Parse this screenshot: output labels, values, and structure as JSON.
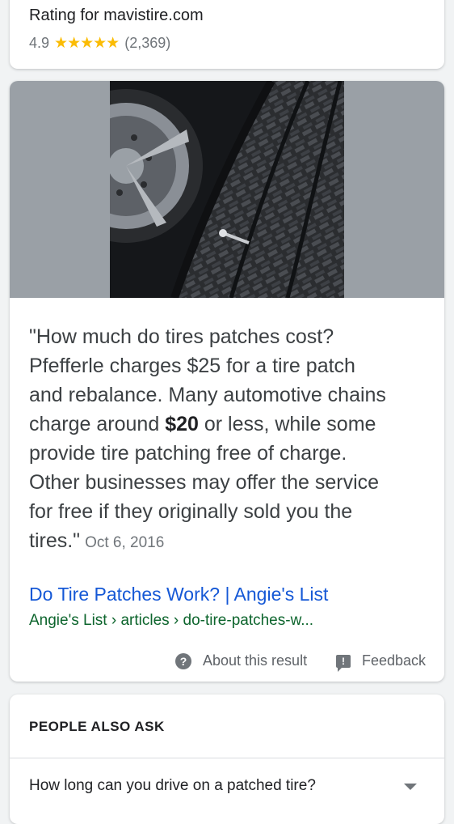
{
  "rating": {
    "title": "Rating for mavistire.com",
    "score": "4.9",
    "stars": "★★★★★",
    "count": "(2,369)"
  },
  "snippet": {
    "quote_line1": "\"How much do tires patches cost?",
    "quote_line2": "Pfefferle charges $25 for a tire patch",
    "quote_line3": "and rebalance. Many automotive chains",
    "quote_line4_pre": "charge around ",
    "quote_line4_bold": "$20",
    "quote_line4_post": " or less, while some",
    "quote_line5": "provide tire patching free of charge.",
    "quote_line6": "Other businesses may offer the service",
    "quote_line7": "for free if they originally sold you the",
    "quote_line8": "tires.\"",
    "date": "Oct 6, 2016",
    "result_title": "Do Tire Patches Work? | Angie's List",
    "result_url": "Angie's List › articles › do-tire-patches-w...",
    "about_label": "About this result",
    "feedback_label": "Feedback",
    "help_glyph": "?",
    "feedback_glyph": "!"
  },
  "paa": {
    "heading": "PEOPLE ALSO ASK",
    "question1": "How long can you drive on a patched tire?"
  },
  "colors": {
    "star": "#fbbc04",
    "link": "#1558d6",
    "url": "#0d652d"
  }
}
